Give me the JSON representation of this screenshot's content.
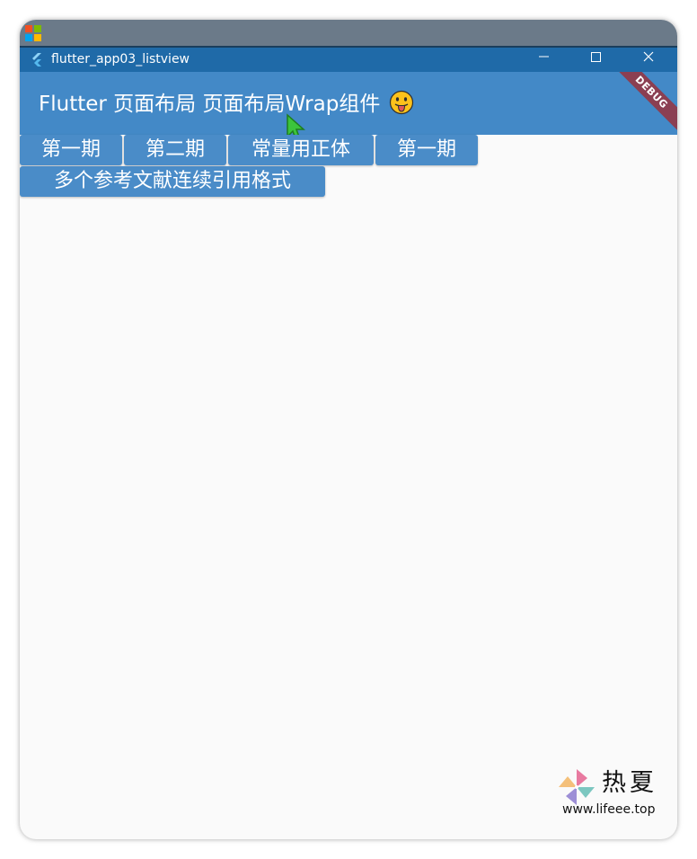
{
  "window": {
    "title": "flutter_app03_listview",
    "controls": [
      "minimize",
      "maximize",
      "close"
    ]
  },
  "app_bar": {
    "title": "Flutter 页面布局 页面布局Wrap组件",
    "emoji": "face-with-tongue",
    "debug_banner": "DEBUG"
  },
  "chips": [
    {
      "label": "第一期"
    },
    {
      "label": "第二期"
    },
    {
      "label": "常量用正体"
    },
    {
      "label": "第一期"
    },
    {
      "label": "多个参考文献连续引用格式"
    }
  ],
  "watermark": {
    "name": "热夏",
    "url": "www.lifeee.top"
  },
  "colors": {
    "outer_bar": "#6b7a89",
    "titlebar": "#1f6aa8",
    "app_bar": "#4389c7",
    "chip": "#4a8cc8",
    "body": "#fafafa",
    "debug_ribbon": "#8b3f52"
  }
}
